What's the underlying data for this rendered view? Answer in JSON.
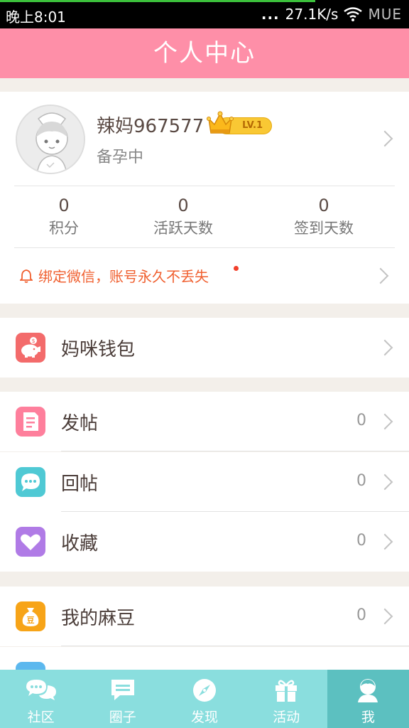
{
  "status_bar": {
    "time": "晚上8:01",
    "dots": "...",
    "speed": "27.1K/s",
    "carrier": "MUE"
  },
  "header": {
    "title": "个人中心"
  },
  "profile": {
    "username": "辣妈967577",
    "level": "LV.1",
    "status": "备孕中",
    "stats": [
      {
        "value": "0",
        "label": "积分"
      },
      {
        "value": "0",
        "label": "活跃天数"
      },
      {
        "value": "0",
        "label": "签到天数"
      }
    ],
    "bind_notice": "绑定微信，账号永久不丢失"
  },
  "menu": {
    "wallet": {
      "label": "妈咪钱包",
      "icon": "piggy-bank-icon",
      "color": "#f36b6b"
    },
    "posts": {
      "label": "发帖",
      "count": "0",
      "icon": "document-icon",
      "color": "#fe7f9c"
    },
    "replies": {
      "label": "回帖",
      "count": "0",
      "icon": "chat-bubble-icon",
      "color": "#4fc9d4"
    },
    "favorites": {
      "label": "收藏",
      "count": "0",
      "icon": "heart-icon",
      "color": "#b07be6"
    },
    "beans": {
      "label": "我的麻豆",
      "count": "0",
      "icon": "money-bag-icon",
      "color": "#f7a418"
    }
  },
  "tabbar": {
    "tabs": [
      {
        "label": "社区",
        "icon": "community-chat-icon"
      },
      {
        "label": "圈子",
        "icon": "message-icon"
      },
      {
        "label": "发现",
        "icon": "compass-icon"
      },
      {
        "label": "活动",
        "icon": "gift-icon"
      },
      {
        "label": "我",
        "icon": "person-icon"
      }
    ],
    "active": "我"
  }
}
